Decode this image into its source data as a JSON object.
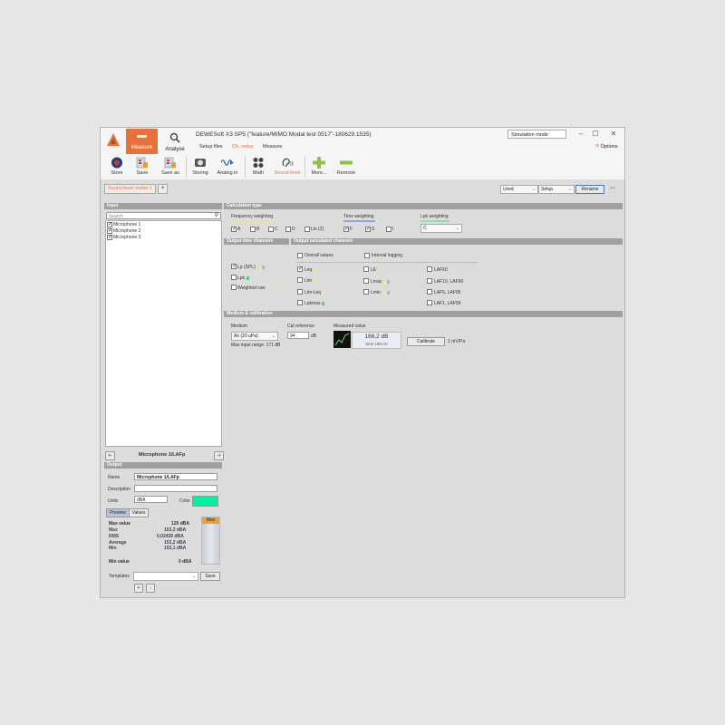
{
  "app": {
    "title": "DEWESoft X3 SP5 (\"feature/MIMO Modal test 0517\"-180629.1535)",
    "mode": "Simulation mode",
    "options_label": "Options",
    "measure_label": "Measure",
    "analyse_label": "Analyse"
  },
  "subtabs": [
    "Setup files",
    "Ch. setup",
    "Measure"
  ],
  "toolbar": [
    {
      "label": "Store",
      "icon": "store-icon"
    },
    {
      "label": "Save",
      "icon": "save-icon"
    },
    {
      "label": "Save as",
      "icon": "save-as-icon"
    },
    {
      "label": "Storing",
      "icon": "storing-icon"
    },
    {
      "label": "Analog in",
      "icon": "analog-in-icon"
    },
    {
      "label": "Math",
      "icon": "math-icon"
    },
    {
      "label": "Sound level",
      "icon": "sound-level-icon"
    },
    {
      "label": "More...",
      "icon": "plus-icon"
    },
    {
      "label": "Remove",
      "icon": "minus-icon"
    }
  ],
  "tabs": {
    "doc_tab": "Sound level meter 1",
    "add_tab": "+",
    "used_combo": "Used",
    "setup_combo": "Setup",
    "rename_btn": "Rename"
  },
  "input": {
    "header": "Input",
    "search_placeholder": "Search",
    "channels": [
      "Microphone 1",
      "Microphone 2",
      "Microphone 3"
    ],
    "nav_prev": "<-",
    "nav_next": "->",
    "current": "Microphone 1/LAFp"
  },
  "calc": {
    "header": "Calculation type",
    "freq_weighting": "Frequency weighting",
    "freq_options": [
      {
        "label": "A",
        "checked": true
      },
      {
        "label": "B",
        "checked": false
      },
      {
        "label": "C",
        "checked": false
      },
      {
        "label": "D",
        "checked": false
      },
      {
        "label": "Lin (Z)",
        "checked": false
      }
    ],
    "time_weighting": "Time weighting",
    "time_options": [
      {
        "label": "F",
        "checked": true
      },
      {
        "label": "S",
        "checked": true
      },
      {
        "label": "I",
        "checked": false
      }
    ],
    "lpk_weighting": "Lpk weighting",
    "lpk_value": "C"
  },
  "output_time": {
    "header": "Output time channels",
    "items": [
      {
        "label": "Lp (SPL)",
        "checked": true
      },
      {
        "label": "Lpk",
        "checked": false
      },
      {
        "label": "Weighted raw",
        "checked": false
      }
    ]
  },
  "output_calc": {
    "header": "Output calculated channels",
    "overall": "Overall values",
    "interval": "Interval logging",
    "col1": [
      {
        "label": "Leq",
        "checked": true
      },
      {
        "label": "Lim",
        "checked": false
      },
      {
        "label": "Lim-Leq",
        "checked": false
      },
      {
        "label": "Lpkmax",
        "checked": false
      }
    ],
    "col2": [
      {
        "label": "LE",
        "checked": false
      },
      {
        "label": "Lmax",
        "checked": false
      },
      {
        "label": "Lmin",
        "checked": false
      }
    ],
    "col3": [
      {
        "label": "LAF50",
        "checked": false
      },
      {
        "label": "LAF10, LAF90",
        "checked": false
      },
      {
        "label": "LAF5, LAF95",
        "checked": false
      },
      {
        "label": "LAF1, LAF99",
        "checked": false
      }
    ]
  },
  "medium": {
    "header": "Medium & calibration",
    "medium_label": "Medium",
    "medium_value": "Air (20 uPa)",
    "max_range": "Max input range: 171 dB",
    "cal_ref_label": "Cal reference",
    "cal_ref_value": "94",
    "cal_unit": "dB",
    "measured_label": "Measured value",
    "measured_value": "166,2 dB",
    "measured_sub": "Sine 180 Hz",
    "calibrate_btn": "Calibrate",
    "sensitivity": "1 mV/Pa"
  },
  "output": {
    "header": "Output",
    "name_label": "Name",
    "name_value": "Microphone 1/LAFp",
    "desc_label": "Description",
    "desc_value": "",
    "units_label": "Units",
    "units_value": "dBA",
    "color_label": "Color",
    "color": "#00f0a0",
    "tab_preview": "Preview",
    "tab_values": "Values",
    "max_value_label": "Max value",
    "max_value": "120 dBA",
    "stats": [
      {
        "label": "Max",
        "value": "153,2 dBA"
      },
      {
        "label": "RMS",
        "value": "0,02439 dBA"
      },
      {
        "label": "Average",
        "value": "153,2 dBA"
      },
      {
        "label": "Min",
        "value": "153,1 dBA"
      }
    ],
    "min_value_label": "Min value",
    "min_value": "0 dBA",
    "bar_label": "Max",
    "templates_label": "Templates",
    "save_btn": "Save",
    "plus_btn": "+",
    "minus_btn": "-"
  },
  "colors": {
    "accent": "#e8703a",
    "header_gray": "#a0a0a0"
  }
}
